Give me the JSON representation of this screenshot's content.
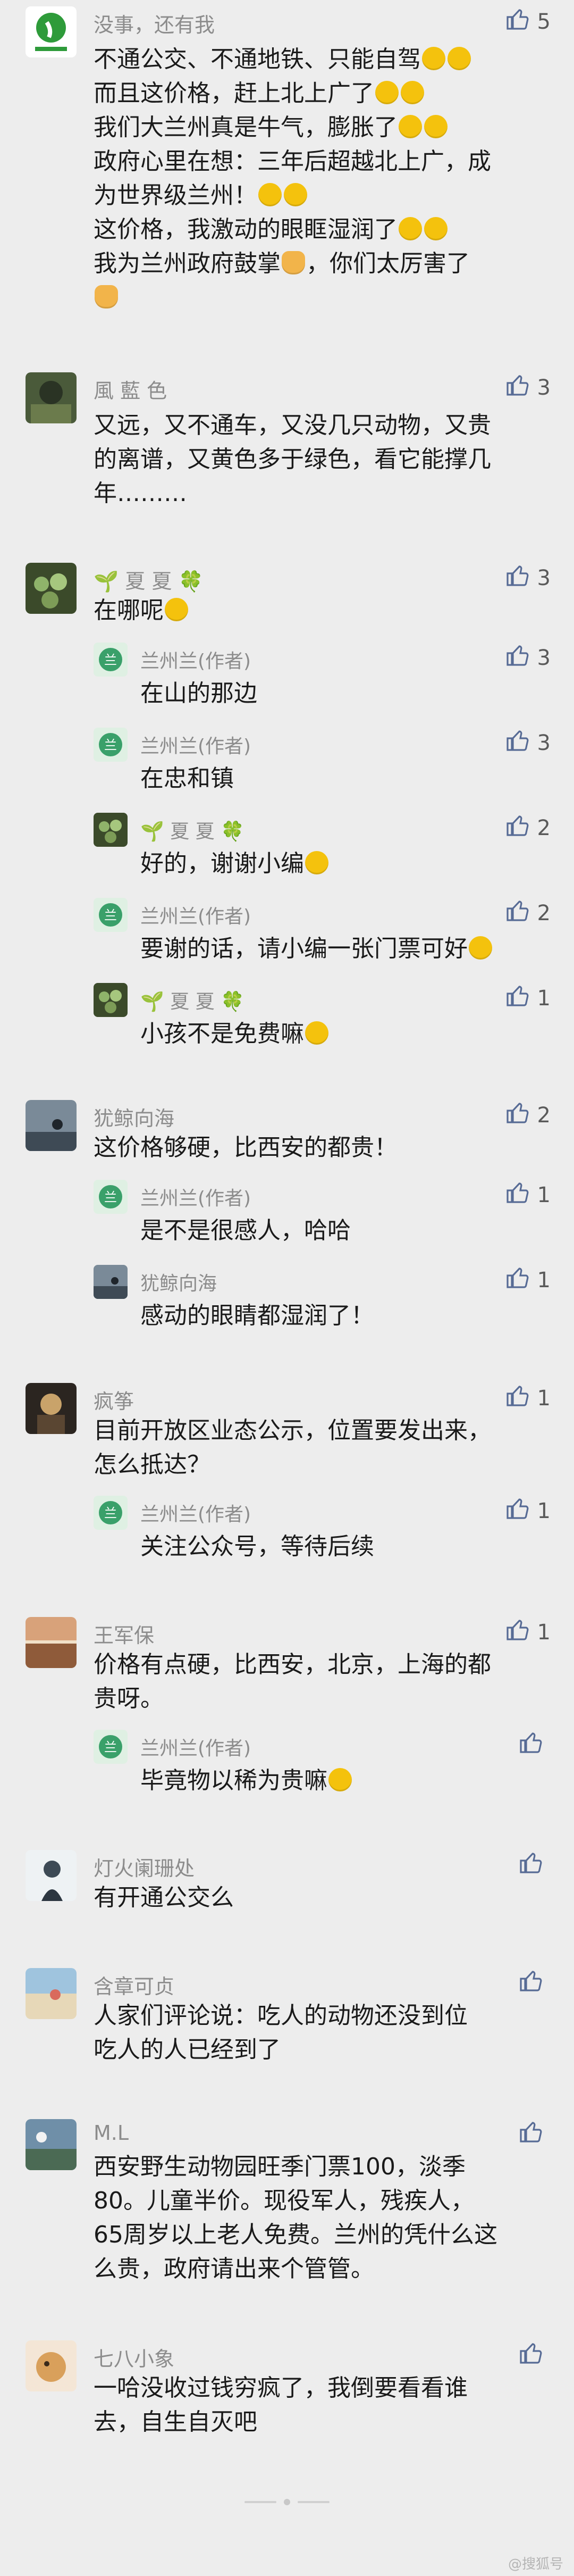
{
  "comments": [
    {
      "name": "没事，还有我",
      "likes": "5",
      "lines": [
        "不通公交、不通地铁、只能自驾",
        "而且这价格，赶上北上广了",
        "我们大兰州真是牛气，膨胀了",
        "政府心里在想：三年后超越北上广，成",
        "为世界级兰州！",
        "这价格，我激动的眼眶湿润了",
        "我为兰州政府鼓掌",
        "，你们太厉害了"
      ]
    },
    {
      "name": "風 藍 色",
      "likes": "3",
      "text": "又远，又不通车，又没几只动物，又贵\n的离谱，又黄色多于绿色，看它能撑几\n年………"
    },
    {
      "name": "夏 夏",
      "likes": "3",
      "text": "在哪呢",
      "replies": [
        {
          "name": "兰州兰(作者)",
          "likes": "3",
          "text": "在山的那边"
        },
        {
          "name": "兰州兰(作者)",
          "likes": "3",
          "text": "在忠和镇"
        },
        {
          "name": "夏 夏",
          "likes": "2",
          "text": "好的，谢谢小编"
        },
        {
          "name": "兰州兰(作者)",
          "likes": "2",
          "text": "要谢的话，请小编一张门票可好"
        },
        {
          "name": "夏 夏",
          "likes": "1",
          "text": "小孩不是免费嘛"
        }
      ]
    },
    {
      "name": "犹鲸向海",
      "likes": "2",
      "text": "这价格够硬，比西安的都贵！",
      "replies": [
        {
          "name": "兰州兰(作者)",
          "likes": "1",
          "text": "是不是很感人，哈哈"
        },
        {
          "name": "犹鲸向海",
          "likes": "1",
          "text": "感动的眼睛都湿润了！"
        }
      ]
    },
    {
      "name": "疯筝",
      "likes": "1",
      "text": "目前开放区业态公示，位置要发出来，\n怎么抵达？",
      "replies": [
        {
          "name": "兰州兰(作者)",
          "likes": "1",
          "text": "关注公众号，等待后续"
        }
      ]
    },
    {
      "name": "王军保",
      "likes": "1",
      "text": "价格有点硬，比西安，北京，上海的都\n贵呀。",
      "replies": [
        {
          "name": "兰州兰(作者)",
          "likes": "",
          "text": "毕竟物以稀为贵嘛"
        }
      ]
    },
    {
      "name": "灯火阑珊处",
      "likes": "",
      "text": "有开通公交么"
    },
    {
      "name": "含章可贞",
      "likes": "",
      "text": "人家们评论说：吃人的动物还没到位\n吃人的人已经到了"
    },
    {
      "name": "M.L",
      "likes": "",
      "text": "西安野生动物园旺季门票100，淡季\n80。儿童半价。现役军人，残疾人，\n65周岁以上老人免费。兰州的凭什么这\n么贵，政府请出来个管管。"
    },
    {
      "name": "七八小象",
      "likes": "",
      "text": "一哈没收过钱穷疯了，我倒要看看谁\n去，自生自灭吧"
    }
  ],
  "watermark": "@搜狐号"
}
